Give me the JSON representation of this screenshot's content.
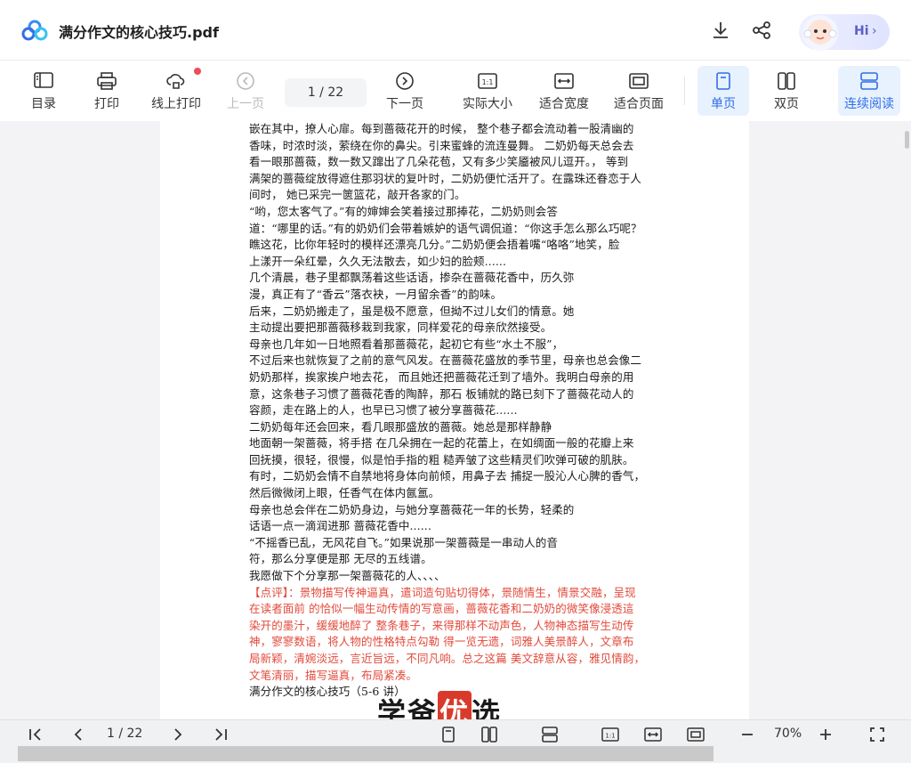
{
  "header": {
    "doc_title": "满分作文的核心技巧.pdf",
    "hi_label": "Hi",
    "hi_chevron": "›"
  },
  "toolbar": {
    "items": [
      {
        "label": "目录",
        "icon": "toc-icon"
      },
      {
        "label": "打印",
        "icon": "printer-icon"
      },
      {
        "label": "线上打印",
        "icon": "cloud-print-icon"
      },
      {
        "label": "上一页",
        "icon": "prev-page-icon"
      },
      {
        "label": "下一页",
        "icon": "next-page-icon"
      },
      {
        "label": "实际大小",
        "icon": "actual-size-icon"
      },
      {
        "label": "适合宽度",
        "icon": "fit-width-icon"
      },
      {
        "label": "适合页面",
        "icon": "fit-page-icon"
      },
      {
        "label": "单页",
        "icon": "single-page-icon"
      },
      {
        "label": "双页",
        "icon": "two-page-icon"
      },
      {
        "label": "连续阅读",
        "icon": "continuous-icon"
      }
    ],
    "page_indicator": "1  /  22"
  },
  "document": {
    "lines": [
      "嵌在其中，撩人心扉。每到蔷薇花开的时候，  整个巷子都会流动着一股清幽的",
      "香味，时浓时淡，萦绕在你的鼻尖。引来蜜蜂的流连曼舞。  二奶奶每天总会去",
      "看一眼那蔷薇，数一数又蹿出了几朵花苞，又有多少笑靥被风儿逗开。，  等到",
      "满架的蔷薇绽放得遮住那羽状的复叶时，二奶奶便忙活开了。在露珠还眷恋于人",
      "间时，  她已采完一篋篮花，敲开各家的门。",
      "        “哟，您太客气了。”有的婶婶会笑着接过那捧花，二奶奶则会答",
      "道：“哪里的话。”有的奶奶们会带着嫉妒的语气调侃道：“你这手怎么那么巧呢？",
      "瞧这花，比你年轻时的模样还漂亮几分。”二奶奶便会捂着嘴“咯咯”地笑，脸",
      "上漾开一朵红晕，久久无法散去，如少妇的脸颊......",
      "            几个清晨，巷子里都飘荡着这些话语，掺杂在蔷薇花香中，历久弥",
      "漫，真正有了“香云”落衣袂，一月留余香”的韵味。",
      "            后来，二奶奶搬走了，虽是极不愿意，但拗不过儿女们的情意。她",
      "主动提出要把那蔷薇移栽到我家，同样爱花的母亲欣然接受。",
      "            母亲也几年如一日地照看着那蔷薇花，起初它有些“水土不服”，",
      "不过后来也就恢复了之前的意气风发。在蔷薇花盛放的季节里，母亲也总会像二",
      "奶奶那样，挨家挨户地去花，  而且她还把蔷薇花迁到了墙外。我明白母亲的用",
      "意，这条巷子习惯了蔷薇花香的陶醉，那石  板铺就的路已刻下了蔷薇花动人的",
      "容颜，走在路上的人，也早已习惯了被分享蔷薇花......",
      "              二奶奶每年还会回来，看几眼那盛放的蔷薇。她总是那样静静",
      "地面朝一架蔷薇，将手搭  在几朵拥在一起的花蕾上，在如绸面一般的花瓣上来",
      "回抚摸，很轻，很慢，似是怕手指的粗  糙弄皱了这些精灵们吹弹可破的肌肤。",
      "有时，二奶奶会情不自禁地将身体向前倾，用鼻子去  捕捉一股沁人心脾的香气，",
      "然后微微闭上眼，任香气在体内氤氲。",
      "            母亲也总会伴在二奶奶身边，与她分享蔷薇花一年的长势，轻柔的",
      "话语一点一滴润进那  蔷薇花香中......",
      "            “不摇香已乱，无风花自飞。”如果说那一架蔷薇是一串动人的音",
      "符，那么分享便是那  无尽的五线谱。",
      "          我愿做下个分享那一架蔷薇花的人、、、、"
    ],
    "comment_lines": [
      "【点评】：景物描写传神逼真，遣词造句贴切得体，景随情生，情景交融，呈现",
      "在读者面前  的恰似一幅生动传情的写意画，蔷薇花香和二奶奶的微笑像浸透這",
      "染开的墨汁，缓缓地醉了  整条巷子，来得那样不动声色，人物神态描写生动传",
      "神，寥寥数语，将人物的性格特点勾勒  得一览无遗，词雅人美景醉人，文章布",
      "局新颖，清婉淡远，言近旨远，不同凡响。总之这篇  美文辞意从容，雅见情韵，",
      "文笔清丽，描写逼真，布局紧凑。"
    ],
    "footer_line": "满分作文的核心技巧（5-6 讲）",
    "watermark_pre": "学爸",
    "watermark_hi": "优",
    "watermark_post": "选"
  },
  "bottombar": {
    "page_indicator": "1  /  22",
    "zoom": "70%"
  },
  "colors": {
    "accent": "#2f6fe8",
    "comment_red": "#e24a3b",
    "active_bg": "#e8f1fe",
    "notification_dot": "#f04b5a"
  }
}
